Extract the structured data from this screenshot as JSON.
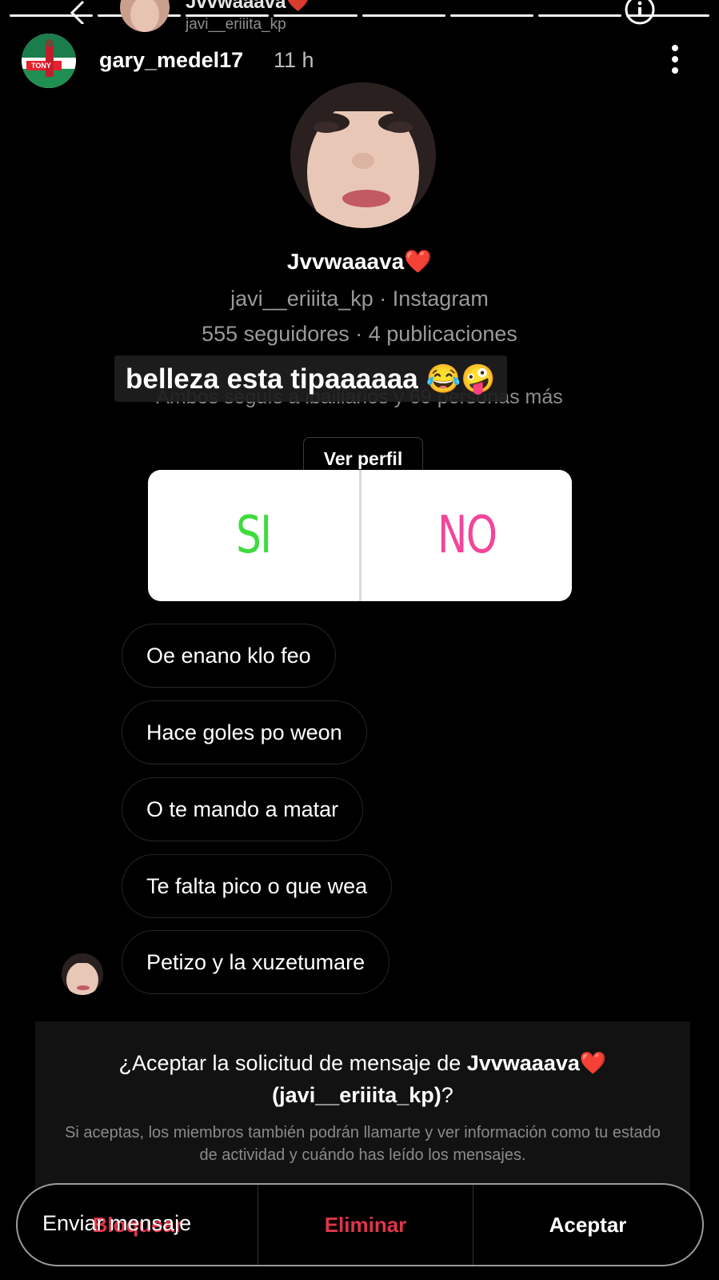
{
  "dm_header": {
    "title": "Jvvwaaava❤️",
    "subtitle": "javi__eriiita_kp"
  },
  "story": {
    "username": "gary_medel17",
    "time": "11 h",
    "avatar_text": "TONY",
    "progress_segments": 8
  },
  "profile": {
    "name": "Jvvwaaava❤️",
    "handle_line": "javi__eriiita_kp · Instagram",
    "stats_line": "555 seguidores · 4 publicaciones",
    "mutuals_line": "Ambos seguís a ibaillarios y 69 personas más",
    "view_profile_label": "Ver perfil"
  },
  "caption": "belleza esta tipaaaaaa 😂🤪",
  "poll": {
    "option_yes": "SI",
    "option_no": "NO",
    "colors": {
      "yes": "#3ddc3d",
      "no": "#f2459b"
    }
  },
  "messages": [
    "Oe enano klo feo",
    "Hace goles po weon",
    "O te mando a matar",
    "Te falta pico o que wea",
    "Petizo y la xuzetumare"
  ],
  "request": {
    "title_prefix": "¿Aceptar la solicitud de mensaje de ",
    "title_name": "Jvvwaaava❤️",
    "title_handle": "(javi__eriiita_kp)",
    "title_suffix": "?",
    "subtitle": "Si aceptas, los miembros también podrán llamarte y ver información como tu estado de actividad y cuándo has leído los mensajes."
  },
  "actions": {
    "block": "Bloquear",
    "delete": "Eliminar",
    "accept": "Aceptar",
    "send_message_overlay": "Enviar mensaje"
  }
}
